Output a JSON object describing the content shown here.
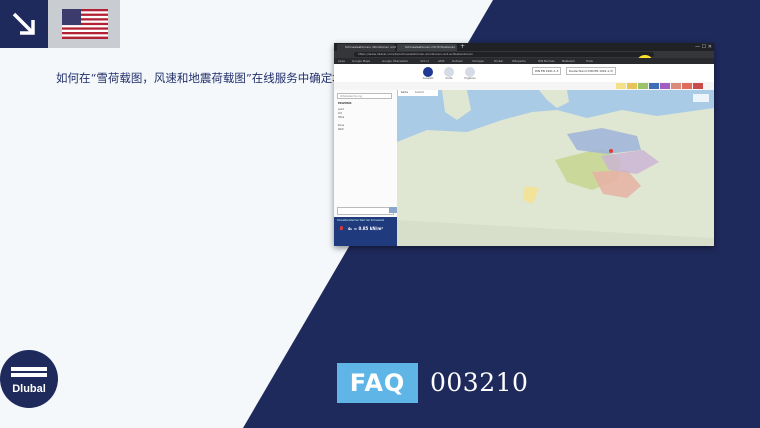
{
  "page": {
    "question": "如何在“雪荷载图，风速和地震荷载图”在线服务中确定地理坐标处的荷载?",
    "faq_badge": "FAQ",
    "faq_number": "003210",
    "logo_text": "Dlubal",
    "language_flag": "us-flag-icon",
    "colors": {
      "navy": "#1f2a5c",
      "accent": "#5fb5e6",
      "background": "#f4f8fb"
    }
  },
  "screenshot": {
    "tabs": [
      {
        "label": "Schneelastzonen, Windzonen und"
      },
      {
        "label": "Schneelastzonen mit Erdbebenzo"
      }
    ],
    "url": "https://www.dlubal.com/de/schneelastzonen-windzonen-und-erdbebenzonen",
    "bookmarks": [
      "Apps",
      "Google Maps",
      "Google Übersetzer",
      "dict.cc",
      "GMX",
      "Outlook",
      "Vorlagen",
      "Dlubal",
      "Wikipedia",
      "DIN Normen",
      "Netzwerk",
      "Tools"
    ],
    "nav": [
      "Auswahl",
      "Karte",
      "Ergebnis"
    ],
    "norms": [
      "DIN EN 1991-1-3",
      "Deutschland (DIN EN 1991-1-3)"
    ],
    "sidebar": {
      "search_placeholder": "Ortsbezeichnung",
      "heading": "ERGEBNIS",
      "rows": [
        "Land",
        "Ort",
        "Höhe",
        "Zone",
        "Wert"
      ],
      "result_label": "Charakteristischer Wert der Schneelast",
      "result_value": "sₖ = 0.85 kN/m²"
    },
    "map_tabs": [
      "Karte",
      "Satellit"
    ]
  }
}
